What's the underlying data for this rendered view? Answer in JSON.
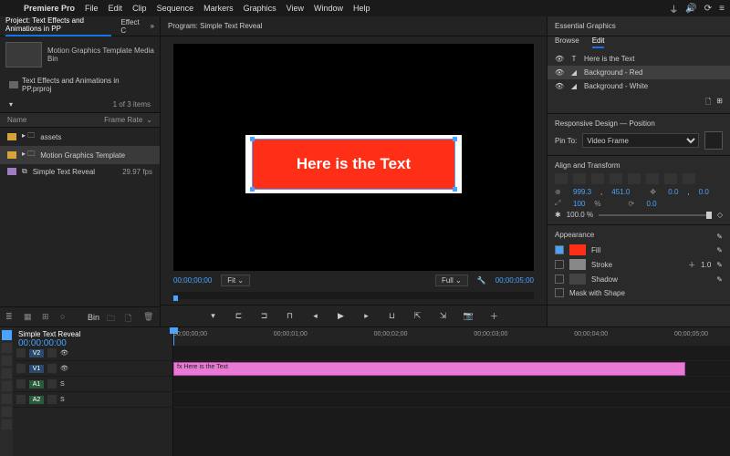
{
  "menubar": {
    "app": "Premiere Pro",
    "items": [
      "File",
      "Edit",
      "Clip",
      "Sequence",
      "Markers",
      "Graphics",
      "View",
      "Window",
      "Help"
    ]
  },
  "projectPanel": {
    "tab1": "Project: Text Effects and Animations in PP",
    "tab2": "Effect C",
    "binName": "Motion Graphics Template Media",
    "binLabel": "Bin",
    "projRow": "Text Effects and Animations in PP.prproj",
    "countText": "1 of 3 items",
    "col1": "Name",
    "col2": "Frame Rate",
    "items": [
      {
        "name": "assets",
        "color": "#d8a33a",
        "fr": ""
      },
      {
        "name": "Motion Graphics Template",
        "color": "#d8a33a",
        "fr": "",
        "sel": true
      },
      {
        "name": "Simple Text Reveal",
        "color": "#a07cc4",
        "fr": "29.97 fps"
      }
    ],
    "footerLabel": "Bin"
  },
  "program": {
    "title": "Program: Simple Text Reveal",
    "previewText": "Here is the Text",
    "tcLeft": "00;00;00;00",
    "fitLabel": "Fit",
    "fullLabel": "Full",
    "tcRight": "00;00;05;00"
  },
  "essentialGraphics": {
    "title": "Essential Graphics",
    "tab1": "Browse",
    "tab2": "Edit",
    "layers": [
      {
        "icon": "T",
        "name": "Here is the Text"
      },
      {
        "icon": "⬛",
        "name": "Background - Red",
        "sel": true
      },
      {
        "icon": "⬛",
        "name": "Background - White"
      }
    ],
    "rd": {
      "title": "Responsive Design — Position",
      "pinLabel": "Pin To:",
      "pinValue": "Video Frame"
    },
    "at": {
      "title": "Align and Transform",
      "posX": "999.3",
      "posY": "451.0",
      "anchX": "0.0",
      "anchY": "0.0",
      "scale": "100",
      "rot": "0.0",
      "opacity": "100.0 %"
    },
    "appearance": {
      "title": "Appearance",
      "fill": {
        "label": "Fill",
        "color": "#ff2e17",
        "on": true
      },
      "stroke": {
        "label": "Stroke",
        "color": "#888",
        "val": "1.0",
        "on": false
      },
      "shadow": {
        "label": "Shadow",
        "color": "#666",
        "on": false
      },
      "mask": "Mask with Shape"
    }
  },
  "timeline": {
    "seqName": "Simple Text Reveal",
    "tc": "00;00;00;00",
    "ticks": [
      "00;00;00;00",
      "00;00;01;00",
      "00;00;02;00",
      "00;00;03;00",
      "00;00;04;00",
      "00;00;05;00"
    ],
    "tracks": {
      "v2": "V2",
      "v1": "V1",
      "a1": "A1",
      "a2": "A2"
    },
    "clipName": "Here is the Text"
  }
}
